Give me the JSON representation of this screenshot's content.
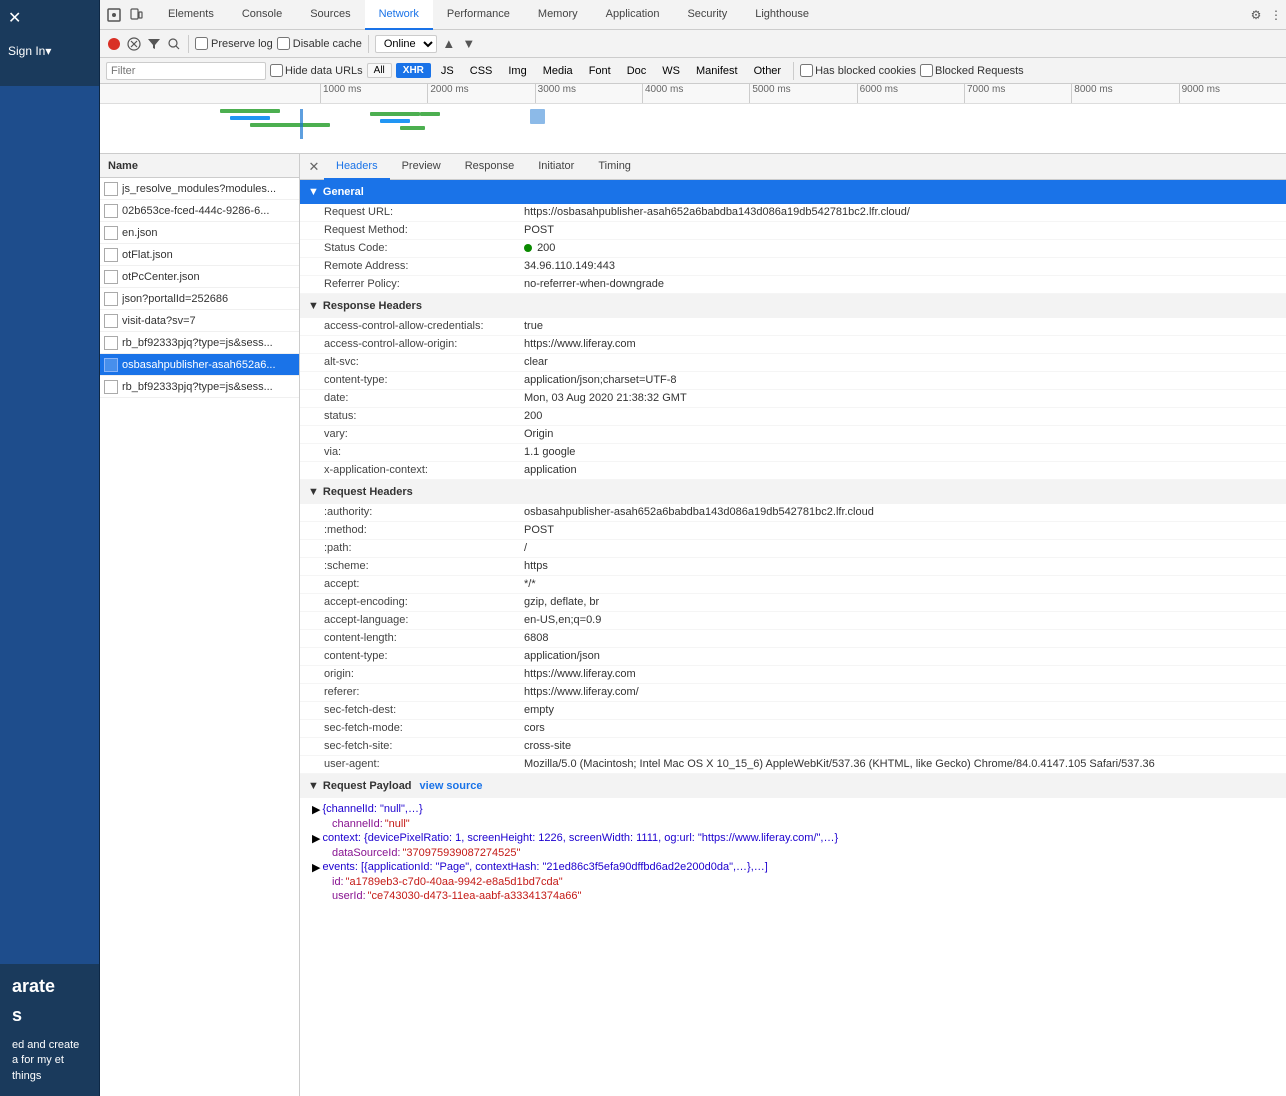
{
  "app": {
    "sign_in": "Sign In",
    "sign_in_arrow": "▾"
  },
  "tabs": [
    {
      "label": "Elements",
      "active": false
    },
    {
      "label": "Console",
      "active": false
    },
    {
      "label": "Sources",
      "active": false
    },
    {
      "label": "Network",
      "active": true
    },
    {
      "label": "Performance",
      "active": false
    },
    {
      "label": "Memory",
      "active": false
    },
    {
      "label": "Application",
      "active": false
    },
    {
      "label": "Security",
      "active": false
    },
    {
      "label": "Lighthouse",
      "active": false
    }
  ],
  "toolbar": {
    "preserve_log": "Preserve log",
    "disable_cache": "Disable cache",
    "online_option": "Online",
    "upload_icon": "▲",
    "download_icon": "▼"
  },
  "filter": {
    "placeholder": "Filter",
    "hide_data_urls": "Hide data URLs",
    "all_label": "All",
    "xhr_label": "XHR",
    "js_label": "JS",
    "css_label": "CSS",
    "img_label": "Img",
    "media_label": "Media",
    "font_label": "Font",
    "doc_label": "Doc",
    "ws_label": "WS",
    "manifest_label": "Manifest",
    "other_label": "Other",
    "has_blocked_cookies": "Has blocked cookies",
    "blocked_requests": "Blocked Requests"
  },
  "timeline": {
    "marks": [
      "1000 ms",
      "2000 ms",
      "3000 ms",
      "4000 ms",
      "5000 ms",
      "6000 ms",
      "7000 ms",
      "8000 ms",
      "9000 ms"
    ]
  },
  "name_list": {
    "header": "Name",
    "items": [
      {
        "name": "js_resolve_modules?modules...",
        "selected": false
      },
      {
        "name": "02b653ce-fced-444c-9286-6...",
        "selected": false
      },
      {
        "name": "en.json",
        "selected": false
      },
      {
        "name": "otFlat.json",
        "selected": false
      },
      {
        "name": "otPcCenter.json",
        "selected": false
      },
      {
        "name": "json?portalId=252686",
        "selected": false
      },
      {
        "name": "visit-data?sv=7",
        "selected": false
      },
      {
        "name": "rb_bf92333pjq?type=js&sess...",
        "selected": false
      },
      {
        "name": "osbasahpublisher-asah652a6...",
        "selected": true
      },
      {
        "name": "rb_bf92333pjq?type=js&sess...",
        "selected": false
      }
    ]
  },
  "detail_tabs": {
    "tabs": [
      "Headers",
      "Preview",
      "Response",
      "Initiator",
      "Timing"
    ],
    "active": "Headers"
  },
  "general": {
    "section_title": "General",
    "request_url_label": "Request URL:",
    "request_url_value": "https://osbasahpublisher-asah652a6babdba143d086a19db542781bc2.lfr.cloud/",
    "request_method_label": "Request Method:",
    "request_method_value": "POST",
    "status_code_label": "Status Code:",
    "status_code_value": "200",
    "remote_address_label": "Remote Address:",
    "remote_address_value": "34.96.110.149:443",
    "referrer_policy_label": "Referrer Policy:",
    "referrer_policy_value": "no-referrer-when-downgrade"
  },
  "response_headers": {
    "section_title": "Response Headers",
    "headers": [
      {
        "name": "access-control-allow-credentials:",
        "value": "true"
      },
      {
        "name": "access-control-allow-origin:",
        "value": "https://www.liferay.com"
      },
      {
        "name": "alt-svc:",
        "value": "clear"
      },
      {
        "name": "content-type:",
        "value": "application/json;charset=UTF-8"
      },
      {
        "name": "date:",
        "value": "Mon, 03 Aug 2020 21:38:32 GMT"
      },
      {
        "name": "status:",
        "value": "200"
      },
      {
        "name": "vary:",
        "value": "Origin"
      },
      {
        "name": "via:",
        "value": "1.1 google"
      },
      {
        "name": "x-application-context:",
        "value": "application"
      }
    ]
  },
  "request_headers": {
    "section_title": "Request Headers",
    "headers": [
      {
        "name": ":authority:",
        "value": "osbasahpublisher-asah652a6babdba143d086a19db542781bc2.lfr.cloud"
      },
      {
        "name": ":method:",
        "value": "POST"
      },
      {
        "name": ":path:",
        "value": "/"
      },
      {
        "name": ":scheme:",
        "value": "https"
      },
      {
        "name": "accept:",
        "value": "*/*"
      },
      {
        "name": "accept-encoding:",
        "value": "gzip, deflate, br"
      },
      {
        "name": "accept-language:",
        "value": "en-US,en;q=0.9"
      },
      {
        "name": "content-length:",
        "value": "6808"
      },
      {
        "name": "content-type:",
        "value": "application/json"
      },
      {
        "name": "origin:",
        "value": "https://www.liferay.com"
      },
      {
        "name": "referer:",
        "value": "https://www.liferay.com/"
      },
      {
        "name": "sec-fetch-dest:",
        "value": "empty"
      },
      {
        "name": "sec-fetch-mode:",
        "value": "cors"
      },
      {
        "name": "sec-fetch-site:",
        "value": "cross-site"
      },
      {
        "name": "user-agent:",
        "value": "Mozilla/5.0 (Macintosh; Intel Mac OS X 10_15_6) AppleWebKit/537.36 (KHTML, like Gecko) Chrome/84.0.4147.105 Safari/537.36"
      }
    ]
  },
  "request_payload": {
    "section_title": "Request Payload",
    "view_source": "view source",
    "tree": {
      "root_label": "{channelId: \"null\",…}",
      "channel_id_label": "channelId:",
      "channel_id_value": "\"null\"",
      "context_label": "context: {devicePixelRatio: 1, screenHeight: 1226, screenWidth: 1111, og:url: \"https://www.liferay.com/\",…}",
      "data_source_id_label": "dataSourceId:",
      "data_source_id_value": "\"370975939087274525\"",
      "events_label": "events: [{applicationId: \"Page\", contextHash: \"21ed86c3f5efa90dffbd6ad2e200d0da\",…},…]",
      "id_label": "id:",
      "id_value": "\"a1789eb3-c7d0-40aa-9942-e8a5d1bd7cda\"",
      "user_id_label": "userId:",
      "user_id_value": "\"ce743030-d473-11ea-aabf-a33341374a66\""
    }
  }
}
